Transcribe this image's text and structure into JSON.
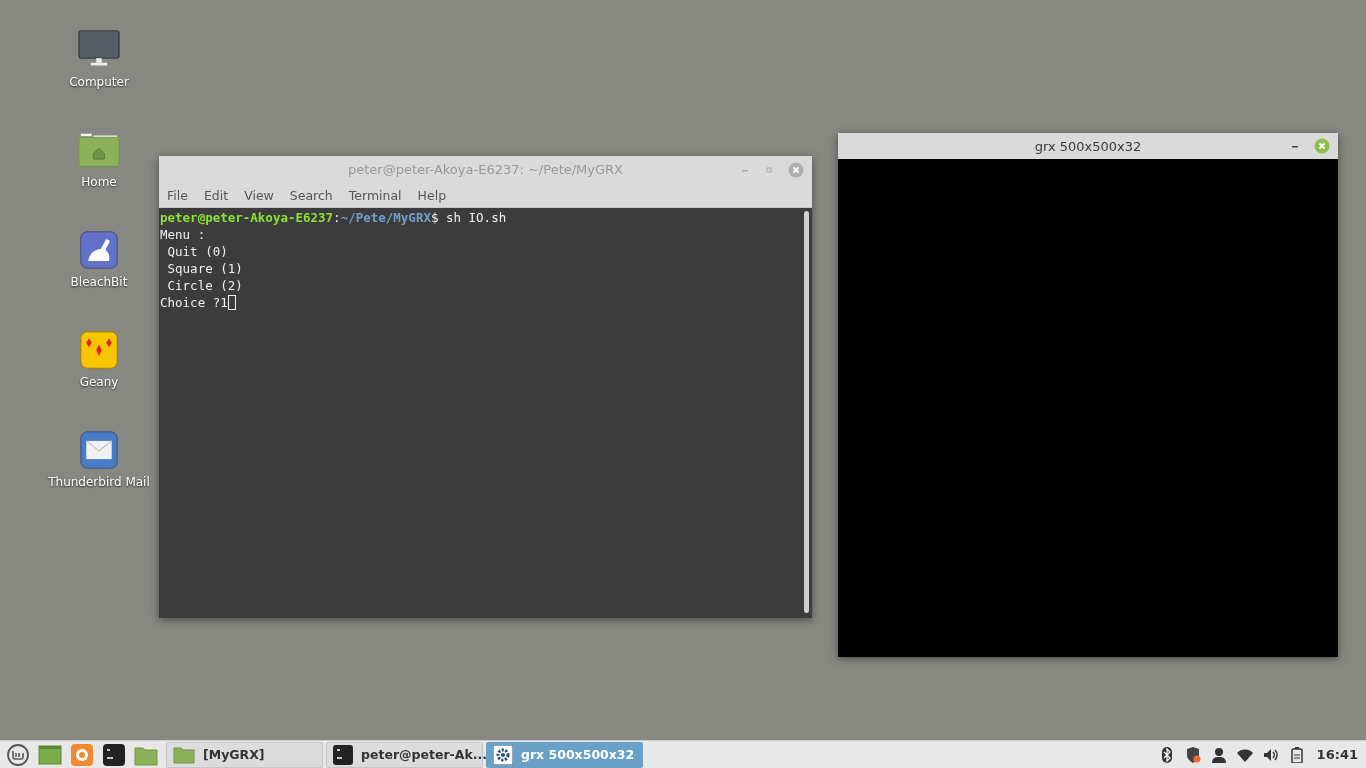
{
  "desktop_icons": [
    {
      "label": "Computer",
      "kind": "monitor"
    },
    {
      "label": "Home",
      "kind": "home-folder"
    },
    {
      "label": "BleachBit",
      "kind": "broom"
    },
    {
      "label": "Geany",
      "kind": "diamonds"
    },
    {
      "label": "Thunderbird Mail",
      "kind": "envelope"
    }
  ],
  "terminal_window": {
    "title": "peter@peter-Akoya-E6237: ~/Pete/MyGRX",
    "active": false,
    "menu": [
      "File",
      "Edit",
      "View",
      "Search",
      "Terminal",
      "Help"
    ],
    "prompt": {
      "user": "peter@peter-Akoya-E6237",
      "separator": ":",
      "path": "~/Pete/MyGRX",
      "command": "$ sh IO.sh"
    },
    "output": [
      "Menu :",
      " Quit (0)",
      " Square (1)",
      " Circle (2)",
      "Choice ?1"
    ]
  },
  "graphics_window": {
    "title": "grx 500x500x32",
    "active": true
  },
  "taskbar": {
    "launchers": [
      {
        "kind": "mint-logo"
      },
      {
        "kind": "desktop"
      },
      {
        "kind": "firefox"
      },
      {
        "kind": "terminal"
      },
      {
        "kind": "folder"
      }
    ],
    "tasks": [
      {
        "label": "[MyGRX]",
        "kind": "folder",
        "selected": false
      },
      {
        "label": "peter@peter-Ak...",
        "kind": "terminal",
        "selected": false
      },
      {
        "label": "grx 500x500x32",
        "kind": "gear",
        "selected": true
      }
    ],
    "tray": [
      {
        "kind": "bluetooth"
      },
      {
        "kind": "shield"
      },
      {
        "kind": "user"
      },
      {
        "kind": "wifi"
      },
      {
        "kind": "volume"
      },
      {
        "kind": "battery"
      }
    ],
    "clock": "16:41"
  }
}
